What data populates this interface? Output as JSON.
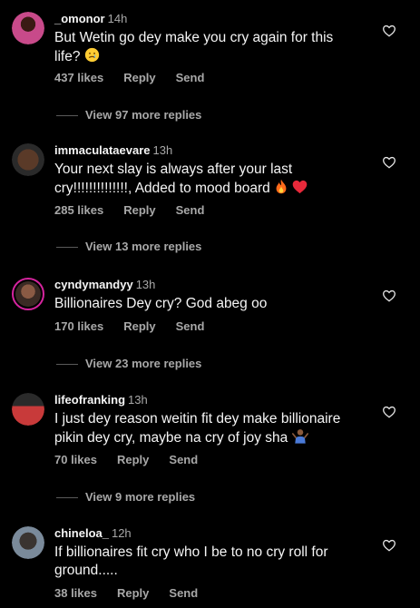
{
  "comments": [
    {
      "username": "_omonor",
      "time": "14h",
      "text": "But Wetin go dey make you cry again for this life?",
      "emoji": "crying-face",
      "likes": "437 likes",
      "reply": "Reply",
      "send": "Send",
      "view_replies": "View 97 more replies",
      "avatar_color": "#7a2a6a"
    },
    {
      "username": "immaculataevare",
      "time": "13h",
      "text": "Your next slay is always after your last cry!!!!!!!!!!!!!!, Added to mood board",
      "emoji": "fire-heart",
      "likes": "285 likes",
      "reply": "Reply",
      "send": "Send",
      "view_replies": "View 13 more replies",
      "avatar_color": "#6b4a36"
    },
    {
      "username": "cyndymandyy",
      "time": "13h",
      "text": "Billionaires Dey cry? God abeg oo",
      "likes": "170 likes",
      "reply": "Reply",
      "send": "Send",
      "view_replies": "View 23 more replies",
      "avatar_color": "#8a6a5a"
    },
    {
      "username": "lifeofranking",
      "time": "13h",
      "text": "I just dey reason weitin fit dey make billionaire pikin dey cry, maybe na cry of joy sha",
      "emoji": "shrug",
      "likes": "70 likes",
      "reply": "Reply",
      "send": "Send",
      "view_replies": "View 9 more replies",
      "avatar_color": "#a83a3a"
    },
    {
      "username": "chineloa_",
      "time": "12h",
      "text": "If billionaires fit cry who I be to no cry roll for ground.....",
      "likes": "38 likes",
      "reply": "Reply",
      "send": "Send",
      "avatar_color": "#5a6a7a"
    }
  ],
  "colors": {
    "background": "#000000",
    "primary_text": "#f5f5f5",
    "secondary_text": "#a8a8a8",
    "story_ring": "#d6249f"
  }
}
